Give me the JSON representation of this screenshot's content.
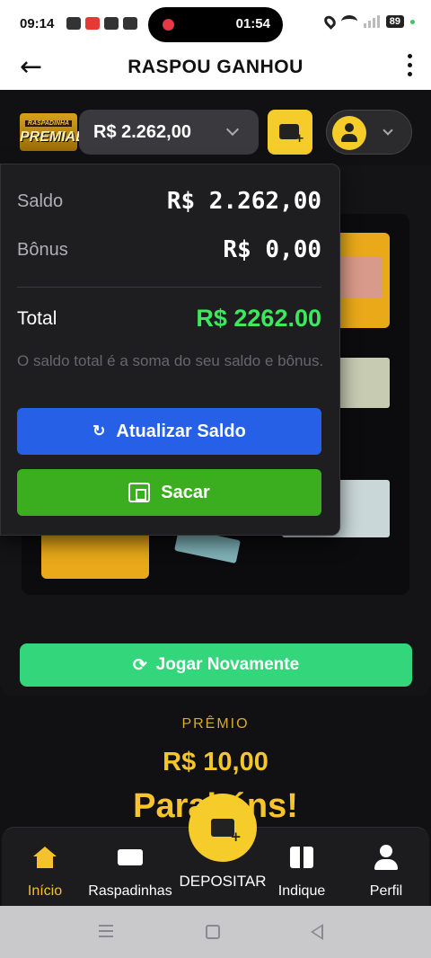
{
  "status_bar": {
    "time": "09:14",
    "recording_time": "01:54",
    "battery": "89"
  },
  "app_bar": {
    "title": "RASPOU GANHOU"
  },
  "header": {
    "logo_top": "RASPADINHA",
    "logo_main": "PREMIADA",
    "balance": "R$ 2.262,00"
  },
  "dropdown": {
    "saldo_label": "Saldo",
    "saldo_value": "R$ 2.262,00",
    "bonus_label": "Bônus",
    "bonus_value": "R$ 0,00",
    "total_label": "Total",
    "total_value": "R$ 2262.00",
    "note": "O saldo total é a soma do seu saldo e bônus.",
    "refresh_button": "Atualizar Saldo",
    "withdraw_button": "Sacar"
  },
  "game": {
    "replay_button": "Jogar Novamente",
    "prize_label": "PRÊMIO",
    "prize_value": "R$ 10,00",
    "congrats": "Parabéns!"
  },
  "bottom_nav": {
    "items": [
      {
        "label": "Início",
        "icon": "home-icon"
      },
      {
        "label": "Raspadinhas",
        "icon": "ticket-icon"
      },
      {
        "label": "DEPOSITAR",
        "icon": "wallet-plus-icon"
      },
      {
        "label": "Indique",
        "icon": "gift-icon"
      },
      {
        "label": "Perfil",
        "icon": "user-icon"
      }
    ]
  },
  "colors": {
    "accent_yellow": "#f5cc2a",
    "total_green": "#3ee85c",
    "refresh_blue": "#2560e6",
    "withdraw_green": "#3aae1e",
    "replay_green": "#33d67a"
  }
}
